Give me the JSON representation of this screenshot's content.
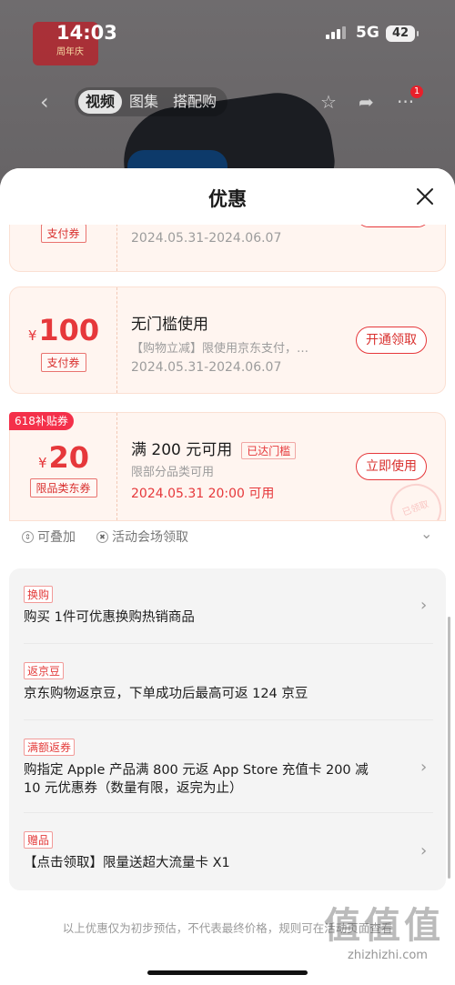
{
  "status_bar": {
    "time": "14:03",
    "network": "5G",
    "battery": "42"
  },
  "product_nav": {
    "tabs": [
      "视频",
      "图集",
      "搭配购"
    ],
    "notification_count": "1",
    "bg_logo_text": "周年庆"
  },
  "sheet": {
    "title": "优惠"
  },
  "coupons": [
    {
      "currency": "",
      "amount": "",
      "tag": "支付券",
      "title": "",
      "subtitle": "",
      "date": "2024.05.31-2024.06.07",
      "button": ""
    },
    {
      "currency": "¥",
      "amount": "100",
      "tag": "支付券",
      "title": "无门槛使用",
      "subtitle": "【购物立减】限使用京东支付，…",
      "date": "2024.05.31-2024.06.07",
      "button": "开通领取"
    },
    {
      "ribbon": "618补贴券",
      "currency": "¥",
      "amount": "20",
      "tag": "限品类东券",
      "title": "满 200 元可用",
      "reached": "已达门槛",
      "subtitle": "限部分品类可用",
      "date": "2024.05.31 20:00 可用",
      "button": "立即使用",
      "stamp": "已领取"
    }
  ],
  "hints": {
    "stackable": "可叠加",
    "venue": "活动会场领取"
  },
  "promotions": [
    {
      "tag": "换购",
      "text": "购买 1件可优惠换购热销商品"
    },
    {
      "tag": "返京豆",
      "text": "京东购物返京豆，下单成功后最高可返 124 京豆"
    },
    {
      "tag": "满额返券",
      "text": "购指定 Apple 产品满 800 元返 App Store 充值卡 200 减 10 元优惠券（数量有限，返完为止）"
    },
    {
      "tag": "赠品",
      "text": "【点击领取】限量送超大流量卡 X1"
    }
  ],
  "disclaimer": "以上优惠仅为初步预估，不代表最终价格，规则可在活动页面查看",
  "watermark": {
    "url": "zhizhizhi.com",
    "logo": "值值值"
  },
  "colors": {
    "accent": "#e6383b",
    "ribbon": "#f4304a",
    "sheet_bg": "#ffffff"
  }
}
